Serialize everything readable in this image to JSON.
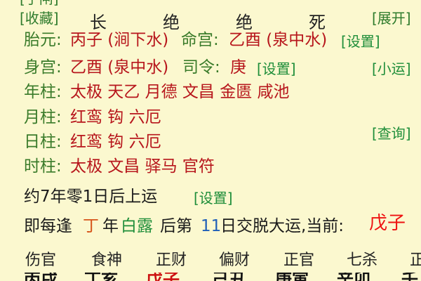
{
  "top_cut": "[手闸]",
  "header": {
    "collect": "[收藏]",
    "stages": [
      "长",
      "绝",
      "绝",
      "死"
    ],
    "expand": "[展开]"
  },
  "rows": {
    "fetal": {
      "label": "胎元:",
      "value": "丙子 (涧下水)",
      "label2": "命宫:",
      "value2": "乙酉 (泉中水)",
      "set": "[设置]"
    },
    "body": {
      "label": "身宫:",
      "value": "乙酉 (泉中水)",
      "label2": "司令:",
      "value2": "庚",
      "set": "[设置]",
      "small_luck": "[小运]"
    },
    "year": {
      "label": "年柱:",
      "value": "太极 天乙 月德 文昌 金匮 咸池"
    },
    "month": {
      "label": "月柱:",
      "value": "红鸾 钩 六厄"
    },
    "day": {
      "label": "日柱:",
      "value": "红鸾 钩 六厄",
      "query": "[查询]"
    },
    "hour": {
      "label": "时柱:",
      "value": "太极 文昌 驿马 官符"
    }
  },
  "luck": {
    "text": "约7年零1日后上运",
    "set": "[设置]"
  },
  "daily": {
    "p1": "即每逢",
    "ding": "丁",
    "p2": "年",
    "bailu": "白露",
    "p3": "后第",
    "num": "11",
    "p4": "日交脱大运,当前:",
    "current": "戊子"
  },
  "ten_gods": [
    "伤官",
    "食神",
    "正财",
    "偏财",
    "正官",
    "七杀",
    "正"
  ],
  "bottom_cut": [
    "丙戌",
    "丁亥",
    "戊子",
    "己丑",
    "庚寅",
    "辛卯",
    "壬"
  ],
  "colors": {
    "background": "#fbf8cf",
    "label_green": "#3a7b2a",
    "value_red": "#b7161c",
    "link_green": "#1f8e3a"
  }
}
